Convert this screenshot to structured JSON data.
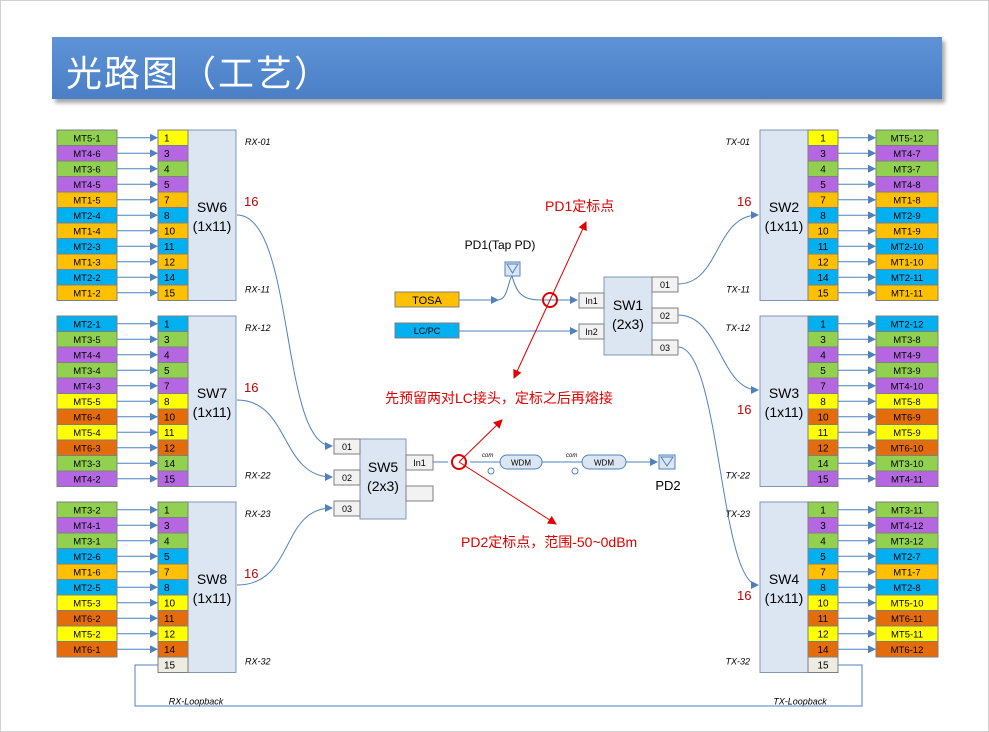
{
  "title": "光路图（工艺）",
  "colors": {
    "title_bg": "#4F81C7",
    "switch_fill": "#DCE6F2",
    "switch_stroke": "#7F96B5",
    "arrow": "#4F81BD",
    "callout_red": "#E00000",
    "label_red": "#C00000",
    "yellow": "#FFFF00",
    "purple": "#B467E0",
    "green": "#92D050",
    "orange": "#FFC000",
    "cyan": "#00B0F0",
    "brown": "#E46C0A",
    "gray": "#EEECE1"
  },
  "colormap": {
    "Y": "#FFFF00",
    "P": "#B467E0",
    "G": "#92D050",
    "O": "#FFC000",
    "C": "#00B0F0",
    "B": "#E46C0A",
    "N": "#EEECE1"
  },
  "left_groups": [
    {
      "name": "SW6",
      "dim": "(1x11)",
      "count": "16",
      "top_label": "RX-01",
      "bottom_label": "RX-11",
      "ports": [
        "1",
        "3",
        "4",
        "5",
        "7",
        "8",
        "10",
        "11",
        "12",
        "14",
        "15"
      ],
      "mts": [
        "MT5-1",
        "MT4-6",
        "MT3-6",
        "MT4-5",
        "MT1-5",
        "MT2-4",
        "MT1-4",
        "MT2-3",
        "MT1-3",
        "MT2-2",
        "MT1-2"
      ],
      "mt_colors": [
        "G",
        "P",
        "G",
        "P",
        "O",
        "C",
        "O",
        "C",
        "O",
        "C",
        "O"
      ],
      "port_colors": [
        "Y",
        "P",
        "G",
        "P",
        "O",
        "C",
        "O",
        "C",
        "O",
        "C",
        "O"
      ]
    },
    {
      "name": "SW7",
      "dim": "(1x11)",
      "count": "16",
      "top_label": "RX-12",
      "bottom_label": "RX-22",
      "ports": [
        "1",
        "3",
        "4",
        "5",
        "7",
        "8",
        "10",
        "11",
        "12",
        "14",
        "15"
      ],
      "mts": [
        "MT2-1",
        "MT3-5",
        "MT4-4",
        "MT3-4",
        "MT4-3",
        "MT5-5",
        "MT6-4",
        "MT5-4",
        "MT6-3",
        "MT3-3",
        "MT4-2"
      ],
      "mt_colors": [
        "C",
        "G",
        "P",
        "G",
        "P",
        "Y",
        "B",
        "Y",
        "B",
        "G",
        "P"
      ],
      "port_colors": [
        "C",
        "G",
        "P",
        "G",
        "P",
        "Y",
        "B",
        "Y",
        "B",
        "G",
        "P"
      ]
    },
    {
      "name": "SW8",
      "dim": "(1x11)",
      "count": "16",
      "top_label": "RX-23",
      "bottom_label": "RX-32",
      "loop_label": "RX-Loopback",
      "ports": [
        "1",
        "3",
        "4",
        "5",
        "7",
        "8",
        "10",
        "11",
        "12",
        "14",
        "15"
      ],
      "mts": [
        "MT3-2",
        "MT4-1",
        "MT3-1",
        "MT2-6",
        "MT1-6",
        "MT2-5",
        "MT5-3",
        "MT6-2",
        "MT5-2",
        "MT6-1",
        ""
      ],
      "mt_colors": [
        "G",
        "P",
        "G",
        "C",
        "O",
        "C",
        "Y",
        "B",
        "Y",
        "B",
        ""
      ],
      "port_colors": [
        "G",
        "P",
        "G",
        "C",
        "O",
        "C",
        "Y",
        "B",
        "Y",
        "B",
        "N"
      ]
    }
  ],
  "right_groups": [
    {
      "name": "SW2",
      "dim": "(1x11)",
      "count": "16",
      "top_label": "TX-01",
      "bottom_label": "TX-11",
      "ports": [
        "1",
        "3",
        "4",
        "5",
        "7",
        "8",
        "10",
        "11",
        "12",
        "14",
        "15"
      ],
      "mts": [
        "MT5-12",
        "MT4-7",
        "MT3-7",
        "MT4-8",
        "MT1-8",
        "MT2-9",
        "MT1-9",
        "MT2-10",
        "MT1-10",
        "MT2-11",
        "MT1-11"
      ],
      "mt_colors": [
        "G",
        "P",
        "G",
        "P",
        "O",
        "C",
        "O",
        "C",
        "O",
        "C",
        "O"
      ],
      "port_colors": [
        "Y",
        "P",
        "G",
        "P",
        "O",
        "C",
        "O",
        "C",
        "O",
        "C",
        "O"
      ]
    },
    {
      "name": "SW3",
      "dim": "(1x11)",
      "count": "16",
      "top_label": "TX-12",
      "bottom_label": "TX-22",
      "ports": [
        "1",
        "3",
        "4",
        "5",
        "7",
        "8",
        "10",
        "11",
        "12",
        "14",
        "15"
      ],
      "mts": [
        "MT2-12",
        "MT3-8",
        "MT4-9",
        "MT3-9",
        "MT4-10",
        "MT5-8",
        "MT6-9",
        "MT5-9",
        "MT6-10",
        "MT3-10",
        "MT4-11"
      ],
      "mt_colors": [
        "C",
        "G",
        "P",
        "G",
        "P",
        "Y",
        "B",
        "Y",
        "B",
        "G",
        "P"
      ],
      "port_colors": [
        "C",
        "G",
        "P",
        "G",
        "P",
        "Y",
        "B",
        "Y",
        "B",
        "G",
        "P"
      ]
    },
    {
      "name": "SW4",
      "dim": "(1x11)",
      "count": "16",
      "top_label": "TX-23",
      "bottom_label": "TX-32",
      "loop_label": "TX-Loopback",
      "ports": [
        "1",
        "3",
        "4",
        "5",
        "7",
        "8",
        "10",
        "11",
        "12",
        "14",
        "15"
      ],
      "mts": [
        "MT3-11",
        "MT4-12",
        "MT3-12",
        "MT2-7",
        "MT1-7",
        "MT2-8",
        "MT5-10",
        "MT6-11",
        "MT5-11",
        "MT6-12",
        ""
      ],
      "mt_colors": [
        "G",
        "P",
        "G",
        "C",
        "O",
        "C",
        "Y",
        "B",
        "Y",
        "B",
        ""
      ],
      "port_colors": [
        "G",
        "P",
        "G",
        "C",
        "O",
        "C",
        "Y",
        "B",
        "Y",
        "B",
        "N"
      ]
    }
  ],
  "sw1": {
    "name": "SW1",
    "dim": "(2x3)",
    "inputs": [
      "In1",
      "In2"
    ],
    "outputs": [
      "01",
      "02",
      "03"
    ]
  },
  "sw5": {
    "name": "SW5",
    "dim": "(2x3)",
    "inputs": [
      "01",
      "02",
      "03"
    ],
    "outputs": [
      "In1"
    ]
  },
  "sources": {
    "tosa": "TOSA",
    "lcpc": "LC/PC"
  },
  "pd1_label": "PD1(Tap PD)",
  "pd2_label": "PD2",
  "wdm_label": "WDM",
  "com_label": "com",
  "callouts": {
    "pd1_cal": "PD1定标点",
    "reserve": "先预留两对LC接头，定标之后再熔接",
    "pd2_cal": "PD2定标点，范围-50~0dBm"
  }
}
